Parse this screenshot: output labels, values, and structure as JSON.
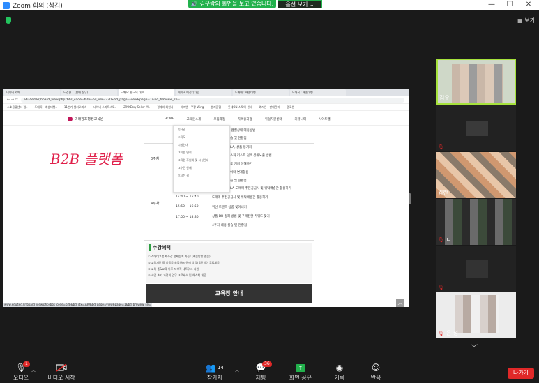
{
  "window": {
    "title": "Zoom 회의 (참김)",
    "share_banner": "김우람의 화면을 보고 있습니다.",
    "view_options": "옵션 보기",
    "min": "—",
    "max": "☐",
    "close": "✕"
  },
  "top_right_view": "보기",
  "browser": {
    "tabs": [
      "네이버 카페",
      "도경환 ...(판매 실무)",
      "도매꾹: 한국의 대표...",
      "네이버 예성디자인",
      "도매매 : 배송대행",
      "도매꾹 : 배송대행"
    ],
    "url": "edu4ed.kr/board_view.php?bbs_code=b2b&bd_idx=330&bd_page=view&page=1&bd_bmview_se=",
    "bookmarks": [
      "소호물류센터 검..",
      "도매꾹 - 배송대행..",
      "11번가 셀러오피스",
      "네이버 스마트스토..",
      "ZINKEtsy Seller M..",
      "경매비 회원사",
      "비즈앤 - 쿠팡 Wing",
      "셀러클럽",
      "롯데ON 스토어 센터",
      "예지완 - 판매관리",
      "엘로윈"
    ],
    "site_logo": "미래창조평생교육원",
    "nav": [
      "HOME",
      "교육원소개",
      "모집과정",
      "자격증과정",
      "취업지원센터",
      "커뮤니티",
      "사이트맵"
    ],
    "dropdown": [
      "인사말",
      "조직도",
      "시설안내",
      "교육원 연혁",
      "교육원 후원회 및 시설안내",
      "교수진 안내",
      "오시는 길"
    ],
    "handwriting": "B2B 플랫폼",
    "schedule": {
      "weeks": [
        "3주차",
        "4주차"
      ],
      "rows": [
        "및 품질상태 대응방법",
        "실습 및 현황점",
        "Q&A, 상품 등기화",
        "최소화 리스트 검색 상위노출 방법",
        "검토 기회 이해하기",
        "데이터 연계활용",
        "실습 및 현황점",
        "Q&A 도매매 추천공급사 및 위탁배송관 활용하기",
        "도매매 추천공급사 및 위탁배송관 활용하기",
        "위산 트렌드 상품 찾아내기",
        "상품 DB 정리 방법 및 구매전환 키워드 찾기",
        "4주차 내용 실습 및 현황점"
      ],
      "times": [
        "14:40 ~ 15:40",
        "15:50 ~ 16:50",
        "17:00 ~ 18:30"
      ]
    },
    "benefit_title": "수강혜택",
    "benefits": [
      "① 스마디그룹 재수강 언제든지 가능! (배움방방 열음)",
      "② 교육기간 중 상품등 솔루션(티엔에 상담) 4단일이 무료제공",
      "③ 교육 중&교육 이후 지속적 네트워크 지원",
      "④ 사업 초기 과정의 업무 프로세스 및 해소책 제공"
    ],
    "cta": "교육장 안내",
    "status_url": "www.edu4ed.kr/board_view.php?bbs_code=b2b&bd_idx=330&bd_page=view&page=1&bd_bmview_se="
  },
  "participants": [
    {
      "name": "김우",
      "mic_muted": false
    },
    {
      "name": "",
      "mic_muted": true
    },
    {
      "name": "김란",
      "mic_muted": false
    },
    {
      "name": "ㅂ",
      "mic_muted": true
    },
    {
      "name": "",
      "mic_muted": true
    },
    {
      "name": "은 정",
      "mic_muted": true
    }
  ],
  "toolbar": {
    "audio": "오디오",
    "audio_badge": "1",
    "video": "비디오 시작",
    "participants": "참가자",
    "participants_count": "14",
    "chat": "채팅",
    "chat_badge": "36",
    "share": "화면 공유",
    "record": "기록",
    "reactions": "반응",
    "leave": "나가기"
  }
}
